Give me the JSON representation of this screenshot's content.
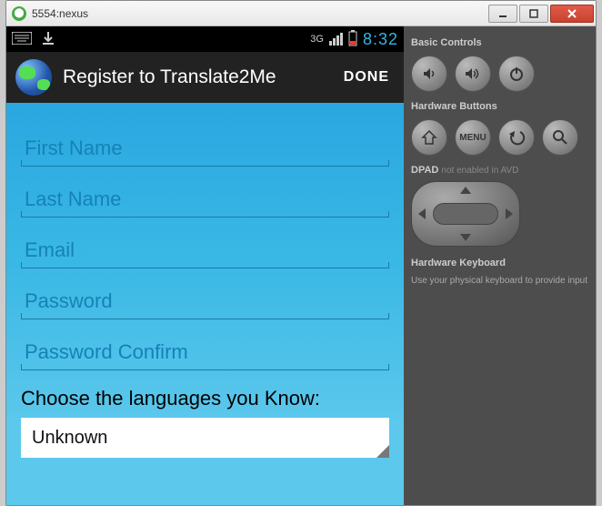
{
  "window": {
    "title": "5554:nexus"
  },
  "status": {
    "signal_label": "3G",
    "time": "8:32"
  },
  "actionbar": {
    "title": "Register to Translate2Me",
    "done": "DONE"
  },
  "form": {
    "first_name": {
      "value": "",
      "placeholder": "First Name"
    },
    "last_name": {
      "value": "",
      "placeholder": "Last Name"
    },
    "email": {
      "value": "",
      "placeholder": "Email"
    },
    "password": {
      "value": "",
      "placeholder": "Password"
    },
    "password_confirm": {
      "value": "",
      "placeholder": "Password Confirm"
    },
    "choose_label": "Choose the languages you Know:",
    "language_selected": "Unknown"
  },
  "controls": {
    "basic_title": "Basic Controls",
    "hw_title": "Hardware Buttons",
    "menu_label": "MENU",
    "dpad_title": "DPAD",
    "dpad_note": "not enabled in AVD",
    "hw_kb_title": "Hardware Keyboard",
    "hw_kb_note": "Use your physical keyboard to provide input"
  }
}
